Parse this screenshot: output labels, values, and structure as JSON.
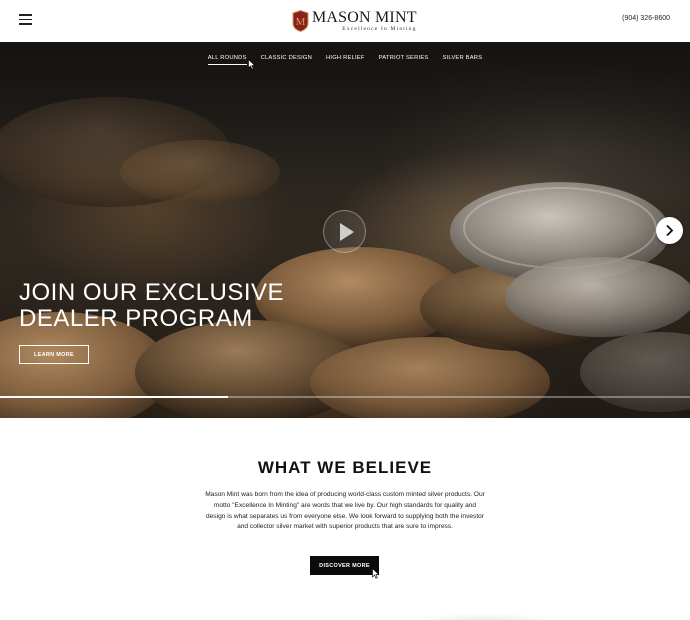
{
  "header": {
    "menu_icon": "hamburger-icon",
    "logo": {
      "name": "MASON MINT",
      "tagline": "Excellence In Minting",
      "emblem_letter": "M"
    },
    "phone": "(904) 326-8600"
  },
  "hero": {
    "nav": [
      {
        "label": "ALL ROUNDS",
        "active": true
      },
      {
        "label": "CLASSIC DESIGN",
        "active": false
      },
      {
        "label": "HIGH RELIEF",
        "active": false
      },
      {
        "label": "PATRIOT SERIES",
        "active": false
      },
      {
        "label": "SILVER BARS",
        "active": false
      }
    ],
    "title_line1": "JOIN OUR EXCLUSIVE",
    "title_line2": "DEALER PROGRAM",
    "button_label": "LEARN MORE",
    "play_icon": "play-icon",
    "next_icon": "chevron-right-icon",
    "slide_progress": 0.33
  },
  "believe": {
    "title": "WHAT WE BELIEVE",
    "body": "Mason Mint was born from the idea of producing world-class custom minted silver products. Our motto \"Excellence In Minting\" are words that we live by. Our high standards for quality and design is what separates us from everyone else. We look forward to supplying both the investor and collector silver market with superior products that are sure to impress.",
    "button_label": "DISCOVER MORE"
  },
  "colors": {
    "logo_red": "#8b1f1f",
    "logo_gold": "#c9a24a",
    "button_dark": "#0b0b0b"
  }
}
